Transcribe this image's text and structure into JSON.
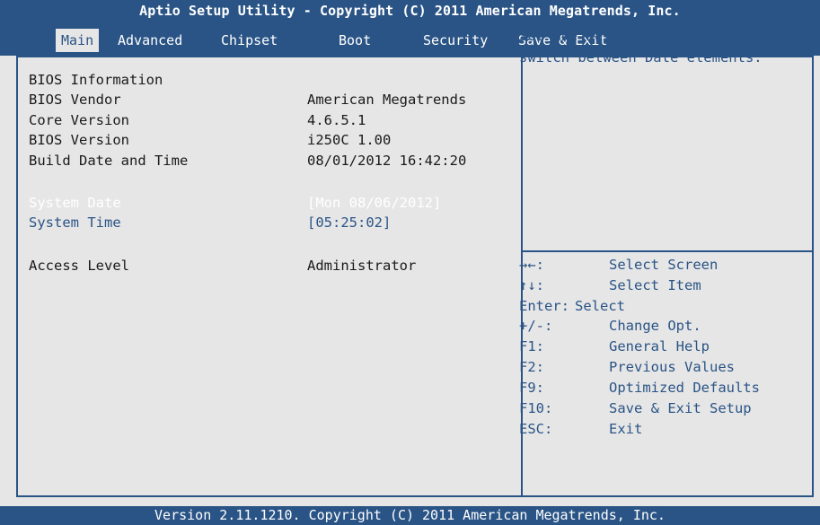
{
  "title": "Aptio Setup Utility - Copyright (C) 2011 American Megatrends, Inc.",
  "tabs": [
    "Main",
    "Advanced",
    "Chipset",
    "Boot",
    "Security",
    "Save & Exit"
  ],
  "main": {
    "section_header": "BIOS Information",
    "info": [
      {
        "label": "BIOS Vendor",
        "value": "American Megatrends"
      },
      {
        "label": "Core Version",
        "value": "4.6.5.1"
      },
      {
        "label": "BIOS Version",
        "value": "i250C 1.00"
      },
      {
        "label": "Build Date and Time",
        "value": "08/01/2012 16:42:20"
      }
    ],
    "system_date": {
      "label": "System Date",
      "value": "[Mon 08/06/2012]"
    },
    "system_time": {
      "label": "System Time",
      "value": "[05:25:02]"
    },
    "access_level": {
      "label": "Access Level",
      "value": "Administrator"
    }
  },
  "help_text": "Set the Date. Use Tab to\nswitch between Date elements.",
  "keys": [
    {
      "key": "→←:",
      "desc": "Select Screen"
    },
    {
      "key": "↑↓:",
      "desc": "Select Item"
    },
    {
      "key": "Enter:",
      "desc": "Select"
    },
    {
      "key": "+/-:",
      "desc": "Change Opt."
    },
    {
      "key": "F1:",
      "desc": "General Help"
    },
    {
      "key": "F2:",
      "desc": "Previous Values"
    },
    {
      "key": "F9:",
      "desc": "Optimized Defaults"
    },
    {
      "key": "F10:",
      "desc": "Save & Exit Setup"
    },
    {
      "key": "ESC:",
      "desc": "Exit"
    }
  ],
  "footer": "Version 2.11.1210. Copyright (C) 2011 American Megatrends, Inc.",
  "colors": {
    "accent": "#2a5486",
    "background": "#e6e6e6",
    "text": "#1a1a1a",
    "selected_text": "#ffffff"
  }
}
